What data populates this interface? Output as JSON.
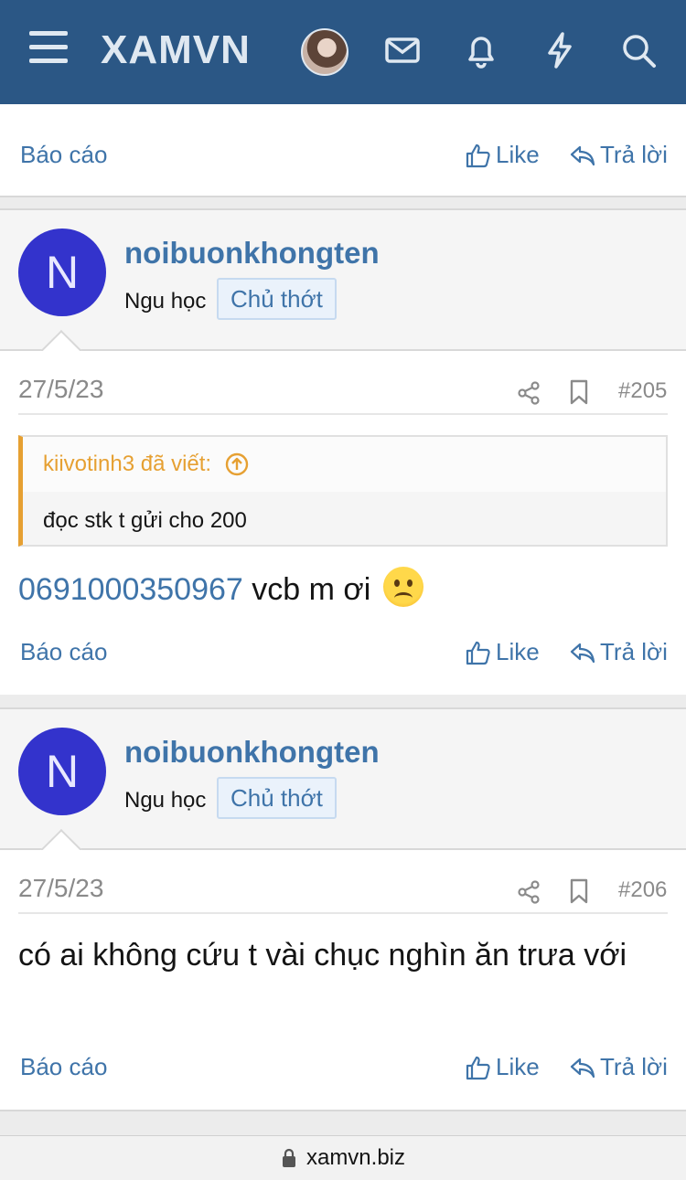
{
  "app": {
    "logo": "XAMVN"
  },
  "header": {
    "icons": [
      "menu-icon",
      "avatar",
      "mail-icon",
      "bell-icon",
      "bolt-icon",
      "search-icon"
    ]
  },
  "actions": {
    "report": "Báo cáo",
    "like": "Like",
    "reply": "Trả lời"
  },
  "posts": [
    {
      "username": "noibuonkhongten",
      "avatar_letter": "N",
      "user_title": "Ngu học",
      "badge": "Chủ thớt",
      "date": "27/5/23",
      "number": "#205",
      "quote": {
        "author": "kiivotinh3 đã viết:",
        "text": "đọc stk t gửi cho 200"
      },
      "link_text": "0691000350967",
      "message": " vcb m ơi",
      "emoji": "frowning-face"
    },
    {
      "username": "noibuonkhongten",
      "avatar_letter": "N",
      "user_title": "Ngu học",
      "badge": "Chủ thớt",
      "date": "27/5/23",
      "number": "#206",
      "message": "có ai không cứu t vài chục nghìn ăn trưa với"
    }
  ],
  "browser": {
    "url": "xamvn.biz"
  },
  "colors": {
    "header": "#2b5785",
    "link": "#3f74a9",
    "quote_accent": "#e6a032",
    "avatar": "#3333cc"
  }
}
